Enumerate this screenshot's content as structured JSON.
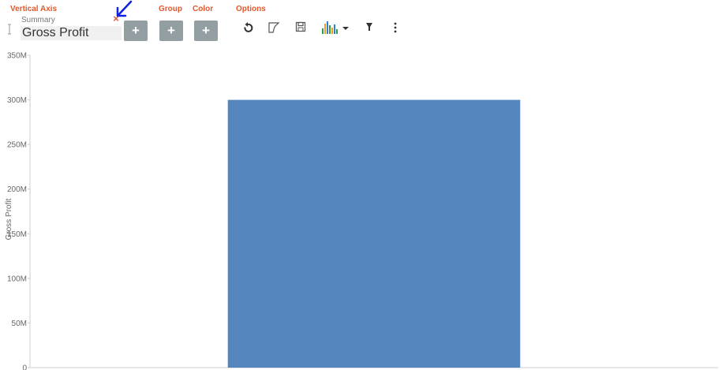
{
  "sections": {
    "vertical_axis": "Vertical Axis",
    "group": "Group",
    "color": "Color",
    "options": "Options"
  },
  "vertical_axis_field": {
    "summary_label": "Summary",
    "field_name": "Gross Profit",
    "remove_icon": "×"
  },
  "add_button_label": "+",
  "icons": [
    "drag-handle-icon",
    "remove-icon",
    "annotation-arrow-icon",
    "refresh-icon",
    "flag-icon",
    "save-icon",
    "chart-type-icon",
    "dropdown-caret-icon",
    "filter-icon",
    "more-icon"
  ],
  "colors": {
    "section_label": "#e8562a",
    "remove": "#e05a3c",
    "add_button": "#939ea3",
    "bar": "#5587be",
    "annotation_arrow": "#1020e0",
    "axis": "#cccccc"
  },
  "chart_data": {
    "type": "bar",
    "categories": [
      ""
    ],
    "values": [
      300000000
    ],
    "ylabel": "Gross Profit",
    "ylim": [
      0,
      350000000
    ],
    "yticks": [
      {
        "value": 0,
        "label": "0"
      },
      {
        "value": 50000000,
        "label": "50M"
      },
      {
        "value": 100000000,
        "label": "100M"
      },
      {
        "value": 150000000,
        "label": "150M"
      },
      {
        "value": 200000000,
        "label": "200M"
      },
      {
        "value": 250000000,
        "label": "250M"
      },
      {
        "value": 300000000,
        "label": "300M"
      },
      {
        "value": 350000000,
        "label": "350M"
      }
    ],
    "grid": false
  }
}
